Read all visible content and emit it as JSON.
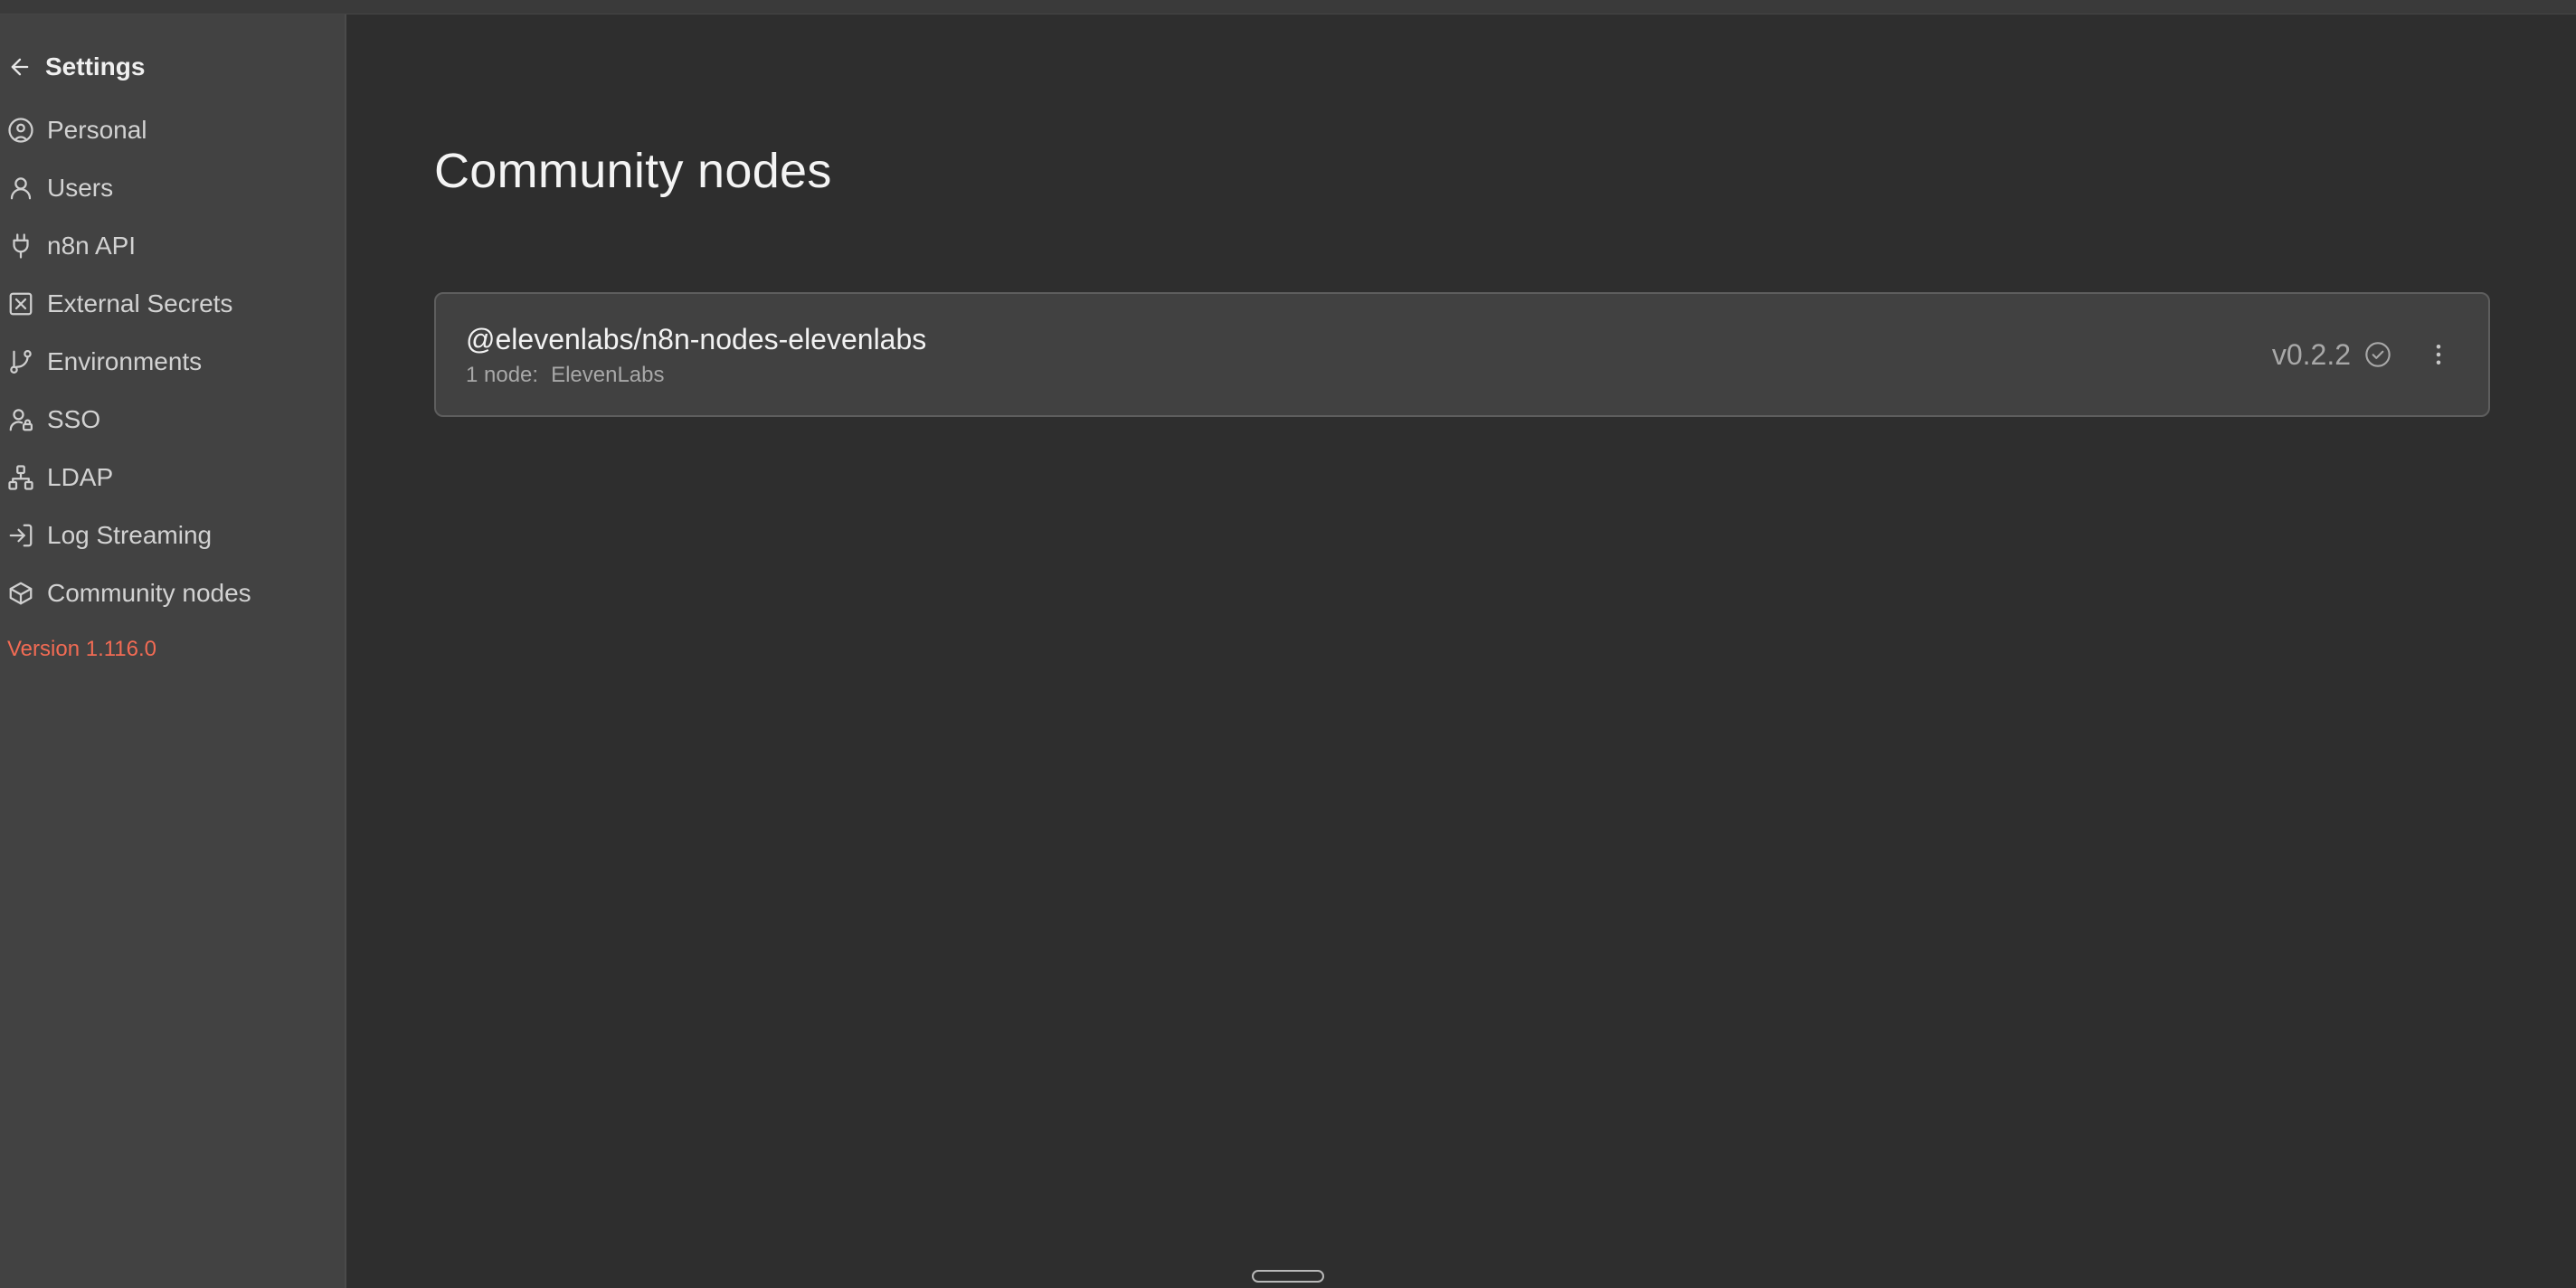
{
  "sidebar": {
    "back_title": "Settings",
    "items": [
      {
        "label": "Personal",
        "icon": "user-circle-icon"
      },
      {
        "label": "Users",
        "icon": "user-icon"
      },
      {
        "label": "n8n API",
        "icon": "plug-icon"
      },
      {
        "label": "External Secrets",
        "icon": "square-x-icon"
      },
      {
        "label": "Environments",
        "icon": "git-branch-icon"
      },
      {
        "label": "SSO",
        "icon": "user-lock-icon"
      },
      {
        "label": "LDAP",
        "icon": "network-icon"
      },
      {
        "label": "Log Streaming",
        "icon": "log-in-icon"
      },
      {
        "label": "Community nodes",
        "icon": "box-icon"
      }
    ],
    "version": "Version 1.116.0"
  },
  "main": {
    "title": "Community nodes",
    "packages": [
      {
        "name": "@elevenlabs/n8n-nodes-elevenlabs",
        "node_count": "1 node:",
        "node_names": "ElevenLabs",
        "version": "v0.2.2"
      }
    ]
  },
  "colors": {
    "background": "#2e2e2e",
    "sidebar": "#424242",
    "accent_version": "#f26b54",
    "card": "#414141"
  }
}
